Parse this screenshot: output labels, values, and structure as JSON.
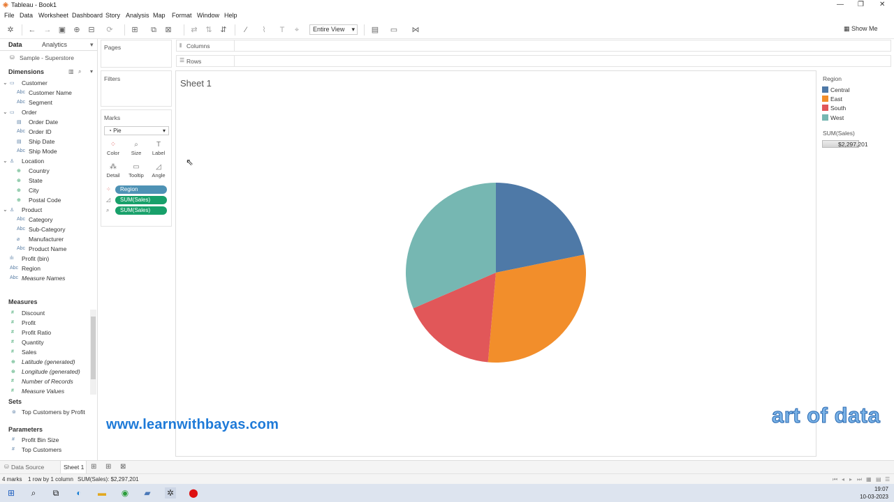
{
  "window": {
    "title": "Tableau - Book1"
  },
  "menu": [
    "File",
    "Data",
    "Worksheet",
    "Dashboard",
    "Story",
    "Analysis",
    "Map",
    "Format",
    "Window",
    "Help"
  ],
  "toolbar": {
    "fit": "Entire View",
    "show_me": "Show Me"
  },
  "data_pane": {
    "tabs": [
      "Data",
      "Analytics"
    ],
    "datasource": "Sample - Superstore",
    "dimensions_label": "Dimensions",
    "dimensions": [
      {
        "label": "Customer",
        "type": "folder"
      },
      {
        "label": "Customer Name",
        "type": "abc"
      },
      {
        "label": "Segment",
        "type": "abc"
      },
      {
        "label": "Order",
        "type": "folder"
      },
      {
        "label": "Order Date",
        "type": "date"
      },
      {
        "label": "Order ID",
        "type": "abc"
      },
      {
        "label": "Ship Date",
        "type": "date"
      },
      {
        "label": "Ship Mode",
        "type": "abc"
      },
      {
        "label": "Location",
        "type": "hier"
      },
      {
        "label": "Country",
        "type": "geo"
      },
      {
        "label": "State",
        "type": "geo"
      },
      {
        "label": "City",
        "type": "geo"
      },
      {
        "label": "Postal Code",
        "type": "geo"
      },
      {
        "label": "Product",
        "type": "hier"
      },
      {
        "label": "Category",
        "type": "abc"
      },
      {
        "label": "Sub-Category",
        "type": "abc"
      },
      {
        "label": "Manufacturer",
        "type": "clip"
      },
      {
        "label": "Product Name",
        "type": "abc"
      },
      {
        "label": "Profit (bin)",
        "type": "bin"
      },
      {
        "label": "Region",
        "type": "abc"
      },
      {
        "label": "Measure Names",
        "type": "abc"
      }
    ],
    "measures_label": "Measures",
    "measures": [
      "Discount",
      "Profit",
      "Profit Ratio",
      "Quantity",
      "Sales",
      "Latitude (generated)",
      "Longitude (generated)",
      "Number of Records",
      "Measure Values"
    ],
    "sets_label": "Sets",
    "sets": [
      "Top Customers by Profit"
    ],
    "parameters_label": "Parameters",
    "parameters": [
      "Profit Bin Size",
      "Top Customers"
    ]
  },
  "cards": {
    "pages": "Pages",
    "filters": "Filters",
    "marks": "Marks",
    "mark_type": "Pie",
    "mark_buttons": [
      "Color",
      "Size",
      "Label",
      "Detail",
      "Tooltip",
      "Angle"
    ],
    "pills": [
      "Region",
      "SUM(Sales)",
      "SUM(Sales)"
    ]
  },
  "shelves": {
    "columns": "Columns",
    "rows": "Rows"
  },
  "view": {
    "sheet_title": "Sheet 1"
  },
  "legend": {
    "title": "Region",
    "items": [
      {
        "label": "Central",
        "color": "#4e79a7"
      },
      {
        "label": "East",
        "color": "#f28e2b"
      },
      {
        "label": "South",
        "color": "#e15759"
      },
      {
        "label": "West",
        "color": "#76b7b2"
      }
    ],
    "size_title": "SUM(Sales)",
    "size_value": "$2,297,201"
  },
  "chart_data": {
    "type": "pie",
    "categories": [
      "Central",
      "East",
      "South",
      "West"
    ],
    "values": [
      0.218,
      0.296,
      0.171,
      0.315
    ],
    "colors": [
      "#4e79a7",
      "#f28e2b",
      "#e15759",
      "#76b7b2"
    ]
  },
  "watermarks": {
    "site": "www.learnwithbayas.com",
    "brand": "art of data"
  },
  "sheet_tabs": {
    "data_source": "Data Source",
    "sheet": "Sheet 1"
  },
  "status": {
    "marks": "4 marks",
    "rows": "1 row by 1 column",
    "sum": "SUM(Sales): $2,297,201"
  },
  "clock": {
    "time": "19:07",
    "date": "10-03-2023"
  }
}
